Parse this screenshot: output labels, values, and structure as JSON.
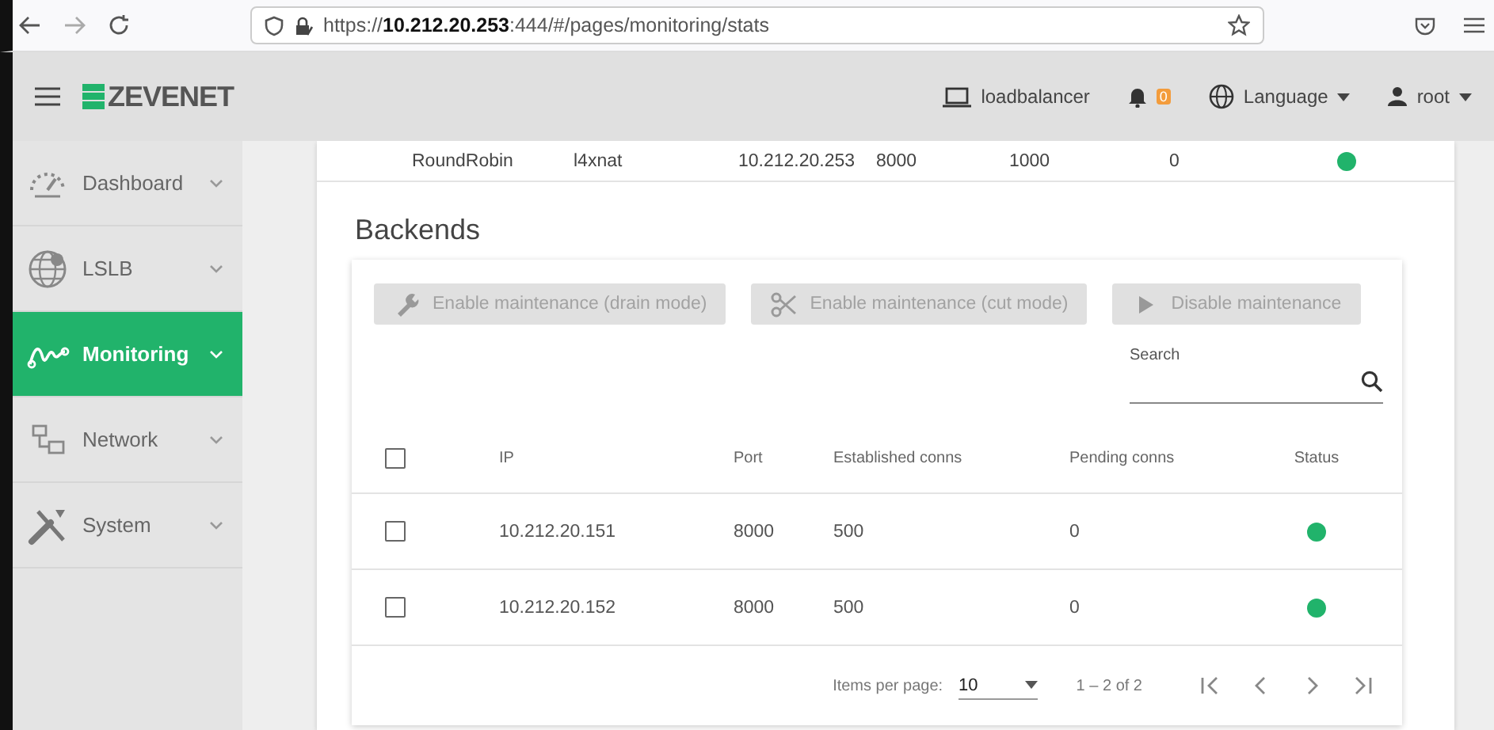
{
  "browser": {
    "url": "https://**10.212.20.253**:444/#/pages/monitoring/stats"
  },
  "header": {
    "logo": "ZEVENET",
    "host": "loadbalancer",
    "notifications": "0",
    "language": "Language",
    "user": "root"
  },
  "sidebar": {
    "items": [
      {
        "label": "Dashboard",
        "selected": false
      },
      {
        "label": "LSLB",
        "selected": false
      },
      {
        "label": "Monitoring",
        "selected": true
      },
      {
        "label": "Network",
        "selected": false
      },
      {
        "label": "System",
        "selected": false
      }
    ]
  },
  "farm_row": {
    "cells": [
      "RoundRobin",
      "l4xnat",
      "10.212.20.253",
      "8000",
      "1000",
      "0"
    ],
    "color": "#21b36b"
  },
  "backends": {
    "title": "Backends",
    "buttons": [
      {
        "label": "Enable maintenance (drain mode)",
        "disabled": true
      },
      {
        "label": "Enable maintenance (cut mode)",
        "disabled": true
      },
      {
        "label": "Disable maintenance",
        "disabled": true
      }
    ],
    "search": {
      "label": "Search"
    },
    "table": {
      "select_all": false,
      "columns": [
        "IP",
        "Port",
        "Established conns",
        "Pending conns",
        "Status"
      ],
      "rows": [
        {
          "checked": false,
          "ip": "10.212.20.151",
          "port": "8000",
          "established": "500",
          "pending": "0",
          "color": "#21b36b"
        },
        {
          "checked": false,
          "ip": "10.212.20.152",
          "port": "8000",
          "established": "500",
          "pending": "0",
          "color": "#21b36b"
        }
      ]
    },
    "paginator": {
      "items_per_page_label": "Items per page:",
      "items_per_page": "10",
      "range": "1 – 2 of 2"
    }
  }
}
